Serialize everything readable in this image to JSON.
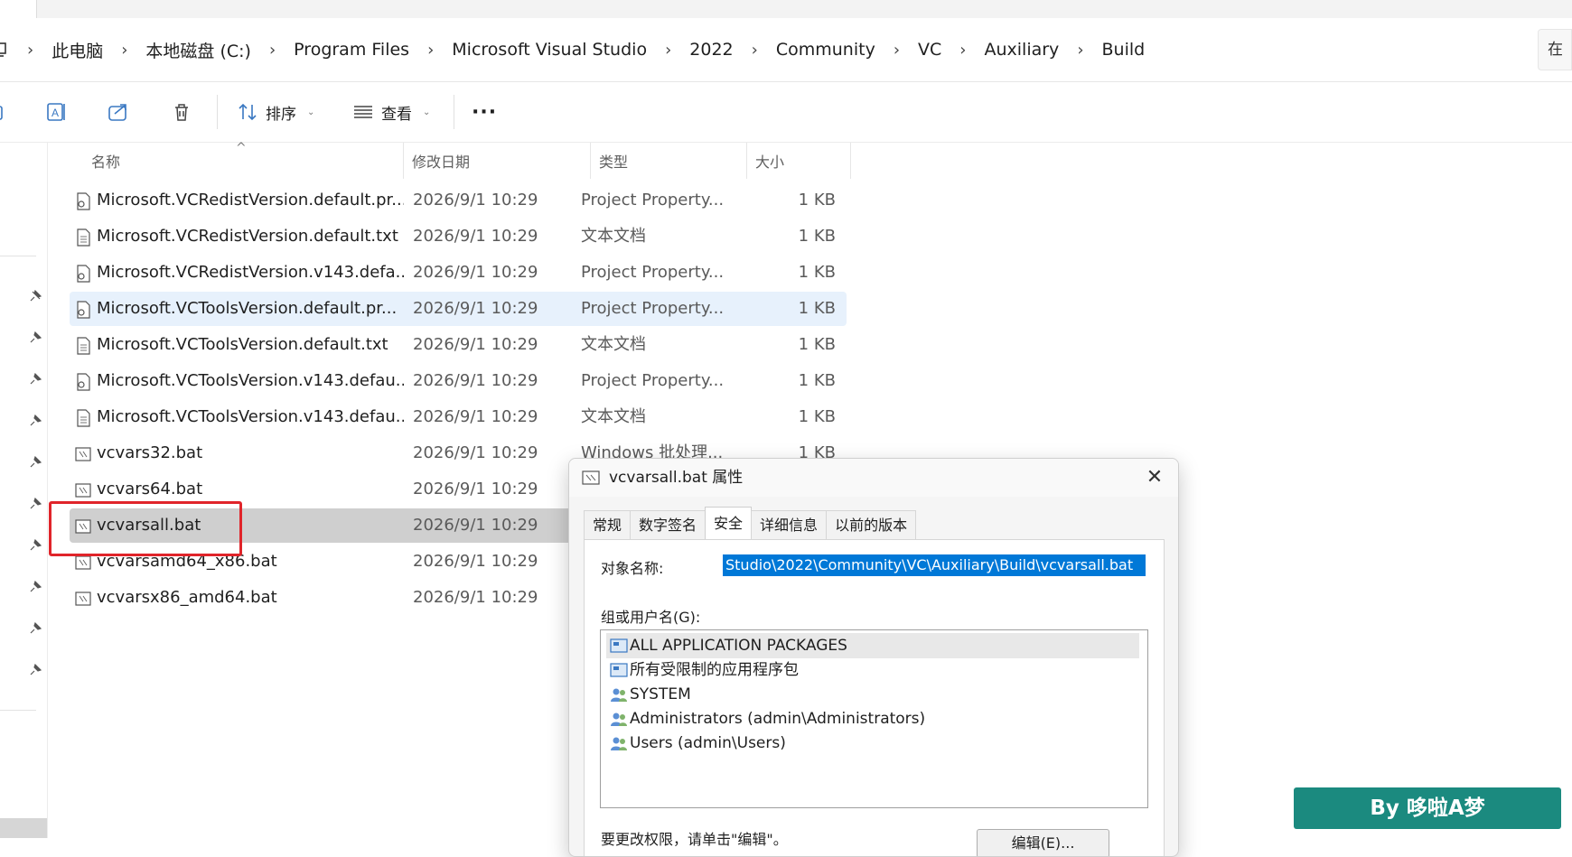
{
  "breadcrumb": {
    "items": [
      "此电脑",
      "本地磁盘 (C:)",
      "Program Files",
      "Microsoft Visual Studio",
      "2022",
      "Community",
      "VC",
      "Auxiliary",
      "Build"
    ],
    "search_placeholder": "在"
  },
  "toolbar": {
    "sort_label": "排序",
    "view_label": "查看",
    "more_label": "···"
  },
  "columns": {
    "name": "名称",
    "date": "修改日期",
    "type": "类型",
    "size": "大小"
  },
  "files": [
    {
      "name": "Microsoft.VCRedistVersion.default.pr...",
      "date": "2026/9/1 10:29",
      "type": "Project Property...",
      "size": "1 KB",
      "icon": "property-file-icon"
    },
    {
      "name": "Microsoft.VCRedistVersion.default.txt",
      "date": "2026/9/1 10:29",
      "type": "文本文档",
      "size": "1 KB",
      "icon": "text-file-icon"
    },
    {
      "name": "Microsoft.VCRedistVersion.v143.defa...",
      "date": "2026/9/1 10:29",
      "type": "Project Property...",
      "size": "1 KB",
      "icon": "property-file-icon"
    },
    {
      "name": "Microsoft.VCToolsVersion.default.pr...",
      "date": "2026/9/1 10:29",
      "type": "Project Property...",
      "size": "1 KB",
      "icon": "property-file-icon"
    },
    {
      "name": "Microsoft.VCToolsVersion.default.txt",
      "date": "2026/9/1 10:29",
      "type": "文本文档",
      "size": "1 KB",
      "icon": "text-file-icon"
    },
    {
      "name": "Microsoft.VCToolsVersion.v143.defau...",
      "date": "2026/9/1 10:29",
      "type": "Project Property...",
      "size": "1 KB",
      "icon": "property-file-icon"
    },
    {
      "name": "Microsoft.VCToolsVersion.v143.defau...",
      "date": "2026/9/1 10:29",
      "type": "文本文档",
      "size": "1 KB",
      "icon": "text-file-icon"
    },
    {
      "name": "vcvars32.bat",
      "date": "2026/9/1 10:29",
      "type": "Windows 批处理...",
      "size": "1 KB",
      "icon": "batch-file-icon"
    },
    {
      "name": "vcvars64.bat",
      "date": "2026/9/1 10:29",
      "type": "",
      "size": "",
      "icon": "batch-file-icon"
    },
    {
      "name": "vcvarsall.bat",
      "date": "2026/9/1 10:29",
      "type": "",
      "size": "",
      "icon": "batch-file-icon"
    },
    {
      "name": "vcvarsamd64_x86.bat",
      "date": "2026/9/1 10:29",
      "type": "",
      "size": "",
      "icon": "batch-file-icon"
    },
    {
      "name": "vcvarsx86_amd64.bat",
      "date": "2026/9/1 10:29",
      "type": "",
      "size": "",
      "icon": "batch-file-icon"
    }
  ],
  "dialog": {
    "title": "vcvarsall.bat 属性",
    "close": "✕",
    "tabs": [
      "常规",
      "数字签名",
      "安全",
      "详细信息",
      "以前的版本"
    ],
    "active_tab": "安全",
    "object_label": "对象名称:",
    "object_value": "Studio\\2022\\Community\\VC\\Auxiliary\\Build\\vcvarsall.bat",
    "group_label": "组或用户名(G):",
    "groups": [
      "ALL APPLICATION PACKAGES",
      "所有受限制的应用程序包",
      "SYSTEM",
      "Administrators (admin\\Administrators)",
      "Users (admin\\Users)"
    ],
    "perm_hint": "要更改权限，请单击\"编辑\"。",
    "edit_button": "编辑(E)..."
  },
  "watermark": "By 哆啦A梦",
  "colors": {
    "hover_row": "#e7f1fc",
    "selected_row": "#cfcfcf",
    "highlight_box": "#e0242a",
    "selection_blue": "#0078d7",
    "watermark_bg": "#1b8a7f"
  }
}
